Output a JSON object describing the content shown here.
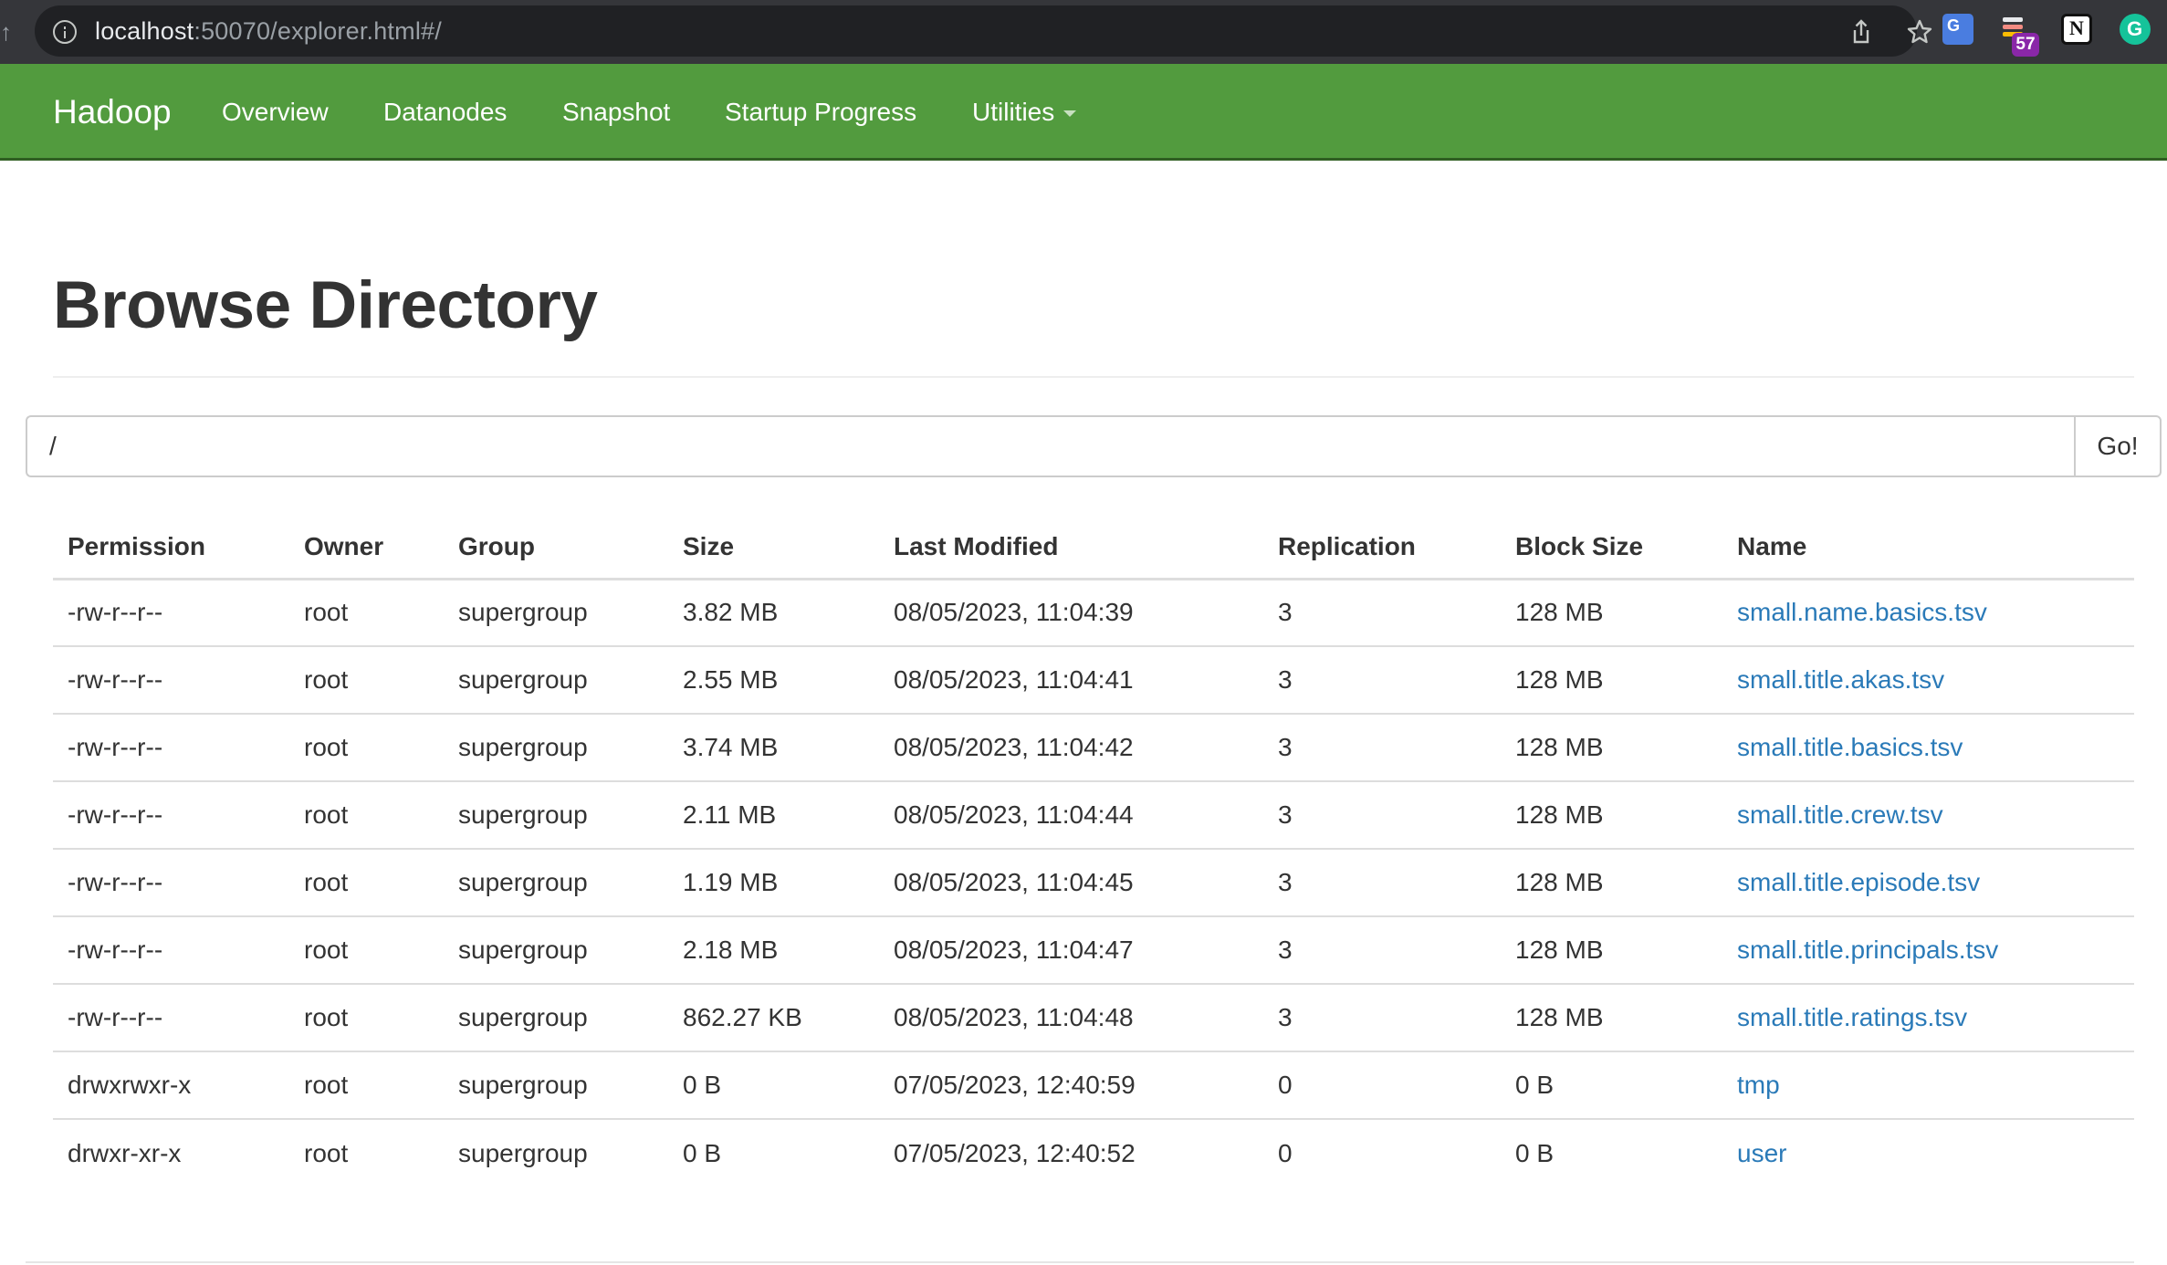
{
  "browser": {
    "url_host": "localhost",
    "url_rest": ":50070/explorer.html#/",
    "extension_badge": "57"
  },
  "navbar": {
    "brand": "Hadoop",
    "items": [
      "Overview",
      "Datanodes",
      "Snapshot",
      "Startup Progress",
      "Utilities"
    ]
  },
  "page": {
    "title": "Browse Directory",
    "path_value": "/",
    "go_label": "Go!"
  },
  "table": {
    "headers": [
      "Permission",
      "Owner",
      "Group",
      "Size",
      "Last Modified",
      "Replication",
      "Block Size",
      "Name"
    ],
    "rows": [
      [
        "-rw-r--r--",
        "root",
        "supergroup",
        "3.82 MB",
        "08/05/2023, 11:04:39",
        "3",
        "128 MB",
        "small.name.basics.tsv"
      ],
      [
        "-rw-r--r--",
        "root",
        "supergroup",
        "2.55 MB",
        "08/05/2023, 11:04:41",
        "3",
        "128 MB",
        "small.title.akas.tsv"
      ],
      [
        "-rw-r--r--",
        "root",
        "supergroup",
        "3.74 MB",
        "08/05/2023, 11:04:42",
        "3",
        "128 MB",
        "small.title.basics.tsv"
      ],
      [
        "-rw-r--r--",
        "root",
        "supergroup",
        "2.11 MB",
        "08/05/2023, 11:04:44",
        "3",
        "128 MB",
        "small.title.crew.tsv"
      ],
      [
        "-rw-r--r--",
        "root",
        "supergroup",
        "1.19 MB",
        "08/05/2023, 11:04:45",
        "3",
        "128 MB",
        "small.title.episode.tsv"
      ],
      [
        "-rw-r--r--",
        "root",
        "supergroup",
        "2.18 MB",
        "08/05/2023, 11:04:47",
        "3",
        "128 MB",
        "small.title.principals.tsv"
      ],
      [
        "-rw-r--r--",
        "root",
        "supergroup",
        "862.27 KB",
        "08/05/2023, 11:04:48",
        "3",
        "128 MB",
        "small.title.ratings.tsv"
      ],
      [
        "drwxrwxr-x",
        "root",
        "supergroup",
        "0 B",
        "07/05/2023, 12:40:59",
        "0",
        "0 B",
        "tmp"
      ],
      [
        "drwxr-xr-x",
        "root",
        "supergroup",
        "0 B",
        "07/05/2023, 12:40:52",
        "0",
        "0 B",
        "user"
      ]
    ]
  },
  "colors": {
    "navbar": "#529b3e",
    "link": "#2a7ab8",
    "chrome": "#35363a"
  }
}
